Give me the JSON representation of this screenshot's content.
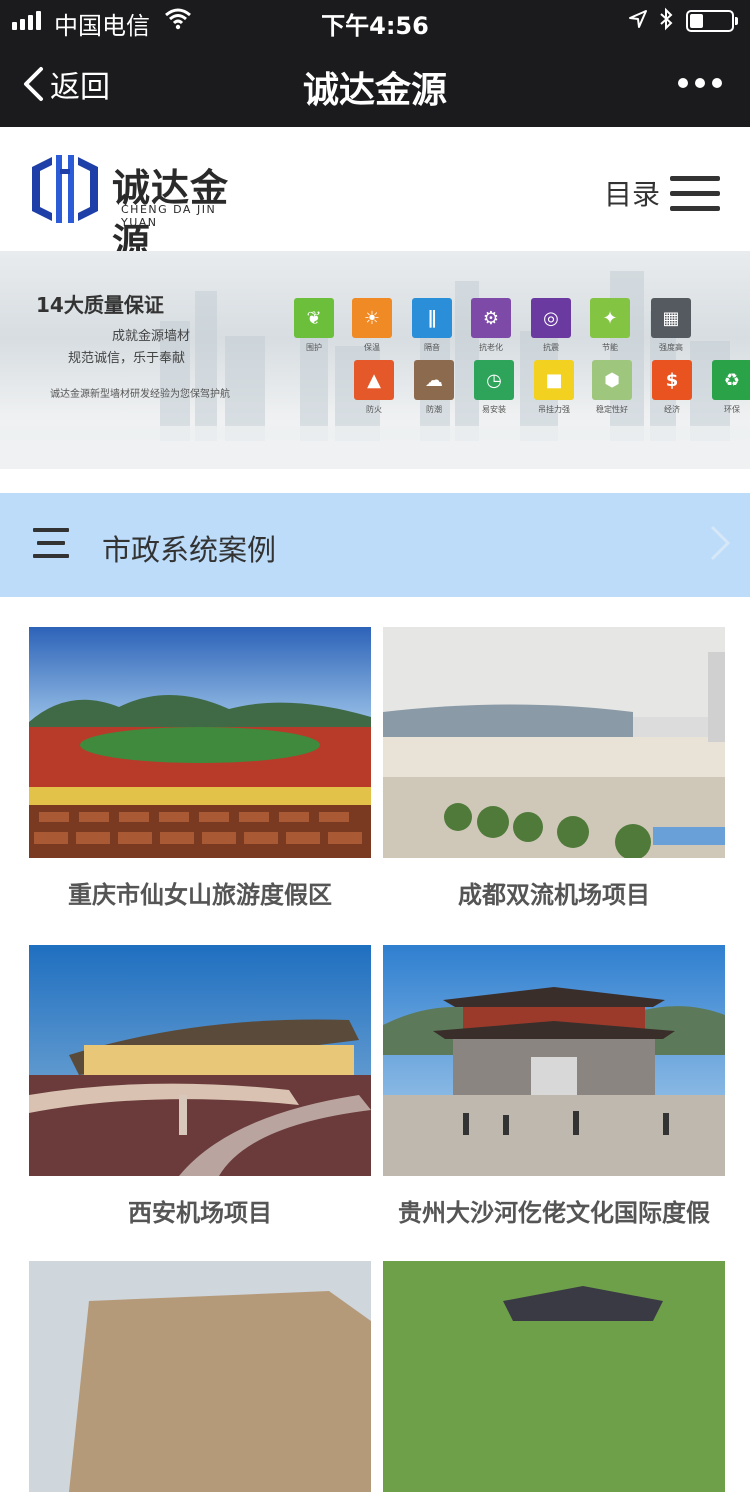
{
  "status_bar": {
    "carrier": "中国电信",
    "time": "下午4:56"
  },
  "nav_bar": {
    "back_label": "返回",
    "title": "诚达金源"
  },
  "site_header": {
    "logo_name": "诚达金源",
    "logo_subtitle": "CHENG DA JIN YUAN",
    "menu_label": "目录"
  },
  "banner": {
    "title": "14大质量保证",
    "line1": "成就金源墙材",
    "line2": "规范诚信，乐于奉献",
    "line3": "诚达金源新型墙材研发经验为您保驾护航",
    "features": [
      {
        "label": "围护",
        "color": "#6bbf3a",
        "icon": "leaf-icon"
      },
      {
        "label": "保温",
        "color": "#f08a24",
        "icon": "sun-icon"
      },
      {
        "label": "隔音",
        "color": "#2a8fd8",
        "icon": "sound-icon"
      },
      {
        "label": "抗老化",
        "color": "#7d4aa8",
        "icon": "gear-icon"
      },
      {
        "label": "抗震",
        "color": "#6a3aa0",
        "icon": "tower-icon"
      },
      {
        "label": "节能",
        "color": "#84c443",
        "icon": "bulb-icon"
      },
      {
        "label": "强度高",
        "color": "#555a60",
        "icon": "keyboard-icon"
      },
      {
        "label": "防火",
        "color": "#e5582a",
        "icon": "fire-icon"
      },
      {
        "label": "防潮",
        "color": "#8c6a4d",
        "icon": "cloud-icon"
      },
      {
        "label": "易安装",
        "color": "#2ea35a",
        "icon": "clock-icon"
      },
      {
        "label": "吊挂力强",
        "color": "#f2d120",
        "icon": "weight-icon"
      },
      {
        "label": "稳定性好",
        "color": "#9ec67d",
        "icon": "hexagon-icon"
      },
      {
        "label": "经济",
        "color": "#e8531f",
        "icon": "dollar-icon"
      },
      {
        "label": "环保",
        "color": "#2aa348",
        "icon": "recycle-icon"
      }
    ]
  },
  "section": {
    "title": "市政系统案例"
  },
  "cases": [
    {
      "caption": "重庆市仙女山旅游度假区"
    },
    {
      "caption": "成都双流机场项目"
    },
    {
      "caption": "西安机场项目"
    },
    {
      "caption": "贵州大沙河仡佬文化国际度假"
    }
  ]
}
